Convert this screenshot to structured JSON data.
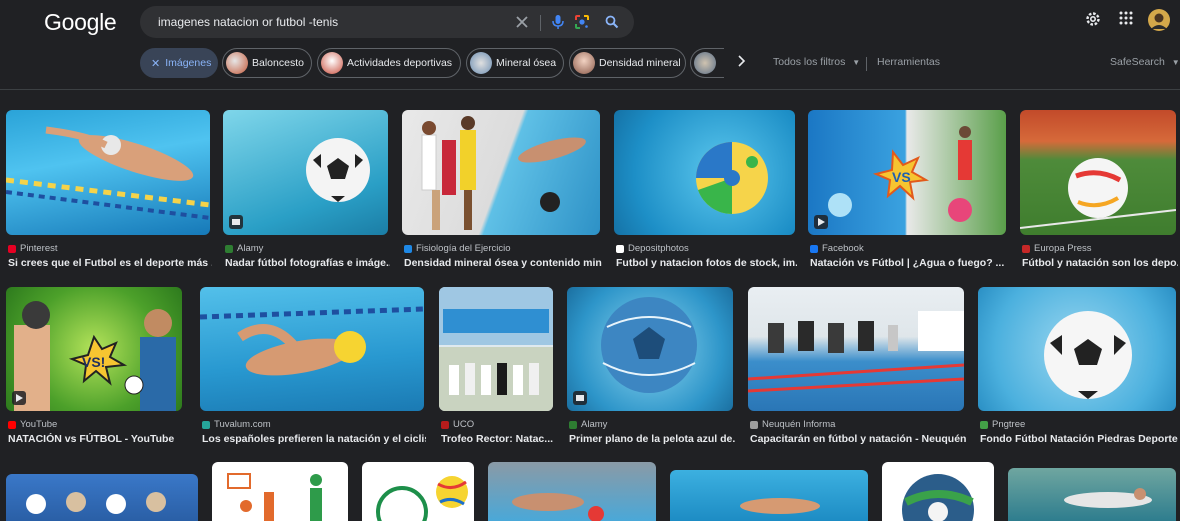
{
  "header": {
    "logo": "Google",
    "query": "imagenes natacion or futbol -tenis"
  },
  "chips": [
    {
      "label": "Imágenes",
      "active": true
    },
    {
      "label": "Baloncesto"
    },
    {
      "label": "Actividades deportivas"
    },
    {
      "label": "Mineral ósea"
    },
    {
      "label": "Densidad mineral"
    },
    {
      "label": ""
    }
  ],
  "tools": {
    "all_filters": "Todos los filtros",
    "tools": "Herramientas",
    "safesearch": "SafeSearch"
  },
  "results_row1": [
    {
      "source": "Pinterest",
      "title": "Si crees que el Futbol es el deporte más ...",
      "fav": "#e60023"
    },
    {
      "source": "Alamy",
      "title": "Nadar fútbol fotografías e imáge...",
      "fav": "#2e7d32"
    },
    {
      "source": "Fisiología del Ejercicio",
      "title": "Densidad mineral ósea y contenido min...",
      "fav": "#1e88e5"
    },
    {
      "source": "Depositphotos",
      "title": "Futbol y natacion fotos de stock, im...",
      "fav": "#ffffff"
    },
    {
      "source": "Facebook",
      "title": "Natación vs Fútbol | ¿Agua o fuego? ...",
      "fav": "#1877f2"
    },
    {
      "source": "Europa Press",
      "title": "Fútbol y natación son los depo...",
      "fav": "#c62828"
    }
  ],
  "results_row2": [
    {
      "source": "YouTube",
      "title": "NATACIÓN vs FÚTBOL - YouTube",
      "fav": "#ff0000"
    },
    {
      "source": "Tuvalum.com",
      "title": "Los españoles prefieren la natación y el ciclis...",
      "fav": "#26a69a"
    },
    {
      "source": "UCO",
      "title": "Trofeo Rector: Natac...",
      "fav": "#b71c1c"
    },
    {
      "source": "Alamy",
      "title": "Primer plano de la pelota azul de...",
      "fav": "#2e7d32"
    },
    {
      "source": "Neuquén Informa",
      "title": "Capacitarán en fútbol y natación - Neuquén...",
      "fav": "#9e9e9e"
    },
    {
      "source": "Pngtree",
      "title": "Fondo Fútbol Natación Piedras Deporte...",
      "fav": "#43a047"
    }
  ]
}
